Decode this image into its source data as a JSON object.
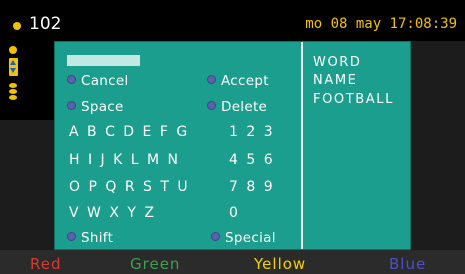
{
  "header": {
    "channel_number": "102",
    "datetime": "mo 08 may 17:08:39"
  },
  "dialog": {
    "buttons": {
      "cancel": "Cancel",
      "accept": "Accept",
      "space": "Space",
      "delete": "Delete",
      "shift": "Shift",
      "special": "Special"
    },
    "keyboard_rows": [
      "A B C D E F G",
      "H I J K L M N",
      "O P Q R S T U",
      "V W X Y Z"
    ],
    "number_rows": [
      "1 2 3",
      "4 5 6",
      "7 8 9",
      "0"
    ],
    "word_list": [
      "WORD",
      "NAME",
      "FOOTBALL"
    ]
  },
  "color_keys": {
    "red": "Red",
    "green": "Green",
    "yellow": "Yellow",
    "blue": "Blue"
  },
  "colors": {
    "red": "#d93a2b",
    "green": "#3aa24a",
    "yellow": "#f2d400",
    "blue": "#4e4fc4",
    "dialog_bg": "#1b9e8e",
    "accent_yellow": "#f2c200"
  }
}
